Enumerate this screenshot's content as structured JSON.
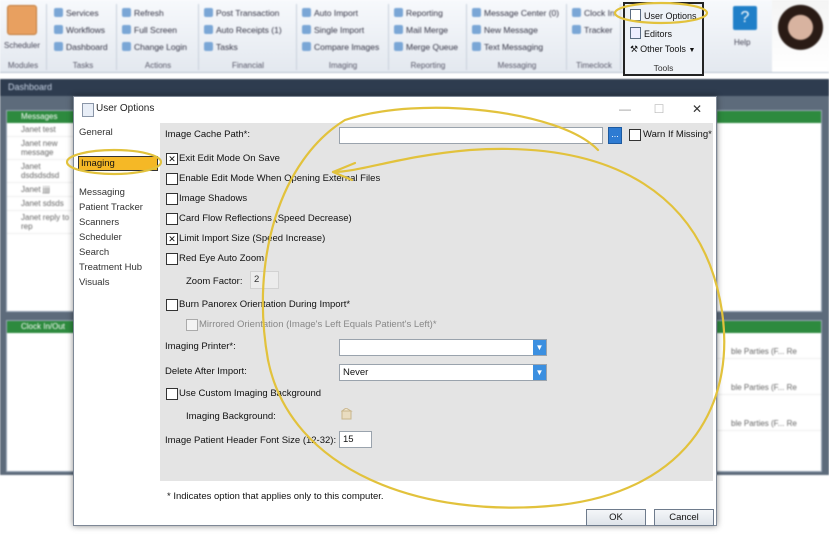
{
  "app": {
    "ribbon": {
      "big_button_label": "Scheduler",
      "groups": [
        {
          "title": "Modules",
          "items": []
        },
        {
          "title": "Tasks",
          "items": [
            "Services",
            "Workflows",
            "Dashboard"
          ]
        },
        {
          "title": "Actions",
          "items": [
            "Refresh",
            "Full Screen",
            "Change Login"
          ]
        },
        {
          "title": "Financial",
          "items": [
            "Post Transaction",
            "Auto Receipts (1)",
            "Tasks"
          ]
        },
        {
          "title": "Imaging",
          "items": [
            "Auto Import",
            "Single Import",
            "Compare Images"
          ]
        },
        {
          "title": "Reporting",
          "items": [
            "Reporting",
            "Mail Merge",
            "Merge Queue"
          ]
        },
        {
          "title": "Messaging",
          "items": [
            "Message Center (0)",
            "New Message",
            "Text Messaging"
          ]
        },
        {
          "title": "Timeclock",
          "items": [
            "Clock In",
            "Tracker"
          ]
        }
      ],
      "tools_group": {
        "title": "Tools",
        "items": [
          "User Options",
          "Editors",
          "Other Tools"
        ]
      },
      "help_label": "Help"
    },
    "dashboard_title": "Dashboard",
    "messages_header": "Messages",
    "clock_header": "Clock In/Out",
    "messages": [
      "Janet test",
      "Janet new message",
      "Janet dsdsdsdsd",
      "Janet jjjj",
      "Janet sdsds",
      "Janet reply to rep"
    ],
    "right_panel_text": "ble Parties (F... Re"
  },
  "dialog": {
    "title": "User Options",
    "controls": {
      "minimize": "—",
      "maximize": "☐",
      "close": "✕"
    },
    "sidebar": [
      {
        "label": "General",
        "selected": false
      },
      {
        "label": "Imaging",
        "selected": true
      },
      {
        "label": "Messaging",
        "selected": false
      },
      {
        "label": "Patient Tracker",
        "selected": false
      },
      {
        "label": "Scanners",
        "selected": false
      },
      {
        "label": "Scheduler",
        "selected": false
      },
      {
        "label": "Search",
        "selected": false
      },
      {
        "label": "Treatment Hub",
        "selected": false
      },
      {
        "label": "Visuals",
        "selected": false
      }
    ],
    "options": {
      "image_cache_path_label": "Image Cache Path*:",
      "image_cache_path_value": "",
      "browse_label": "...",
      "warn_if_missing_label": "Warn If Missing*",
      "warn_if_missing_checked": false,
      "exit_edit_mode_label": "Exit Edit Mode On Save",
      "exit_edit_mode_checked": true,
      "enable_edit_mode_label": "Enable Edit Mode When Opening External Files",
      "enable_edit_mode_checked": false,
      "image_shadows_label": "Image Shadows",
      "image_shadows_checked": false,
      "card_flow_label": "Card Flow Reflections (Speed Decrease)",
      "card_flow_checked": false,
      "limit_import_label": "Limit Import Size (Speed Increase)",
      "limit_import_checked": true,
      "red_eye_label": "Red Eye Auto Zoom",
      "red_eye_checked": false,
      "zoom_factor_label": "Zoom Factor:",
      "zoom_factor_value": "2",
      "burn_panorex_label": "Burn Panorex Orientation During Import*",
      "burn_panorex_checked": false,
      "mirrored_label": "Mirrored Orientation (Image's Left Equals Patient's Left)*",
      "mirrored_checked": false,
      "imaging_printer_label": "Imaging Printer*:",
      "imaging_printer_value": "",
      "delete_after_import_label": "Delete After Import:",
      "delete_after_import_value": "Never",
      "custom_background_label": "Use Custom Imaging Background",
      "custom_background_checked": false,
      "imaging_background_label": "Imaging Background:",
      "header_font_size_label": "Image Patient Header Font Size (12-32):",
      "header_font_size_value": "15"
    },
    "footnote": "* Indicates option that applies only to this computer.",
    "ok_label": "OK",
    "cancel_label": "Cancel"
  },
  "colors": {
    "annotation": "#e2c23c",
    "selection": "#f5b826",
    "dialog_content_bg": "#e4e4e4",
    "dropdown_accent": "#3b8fe0"
  }
}
